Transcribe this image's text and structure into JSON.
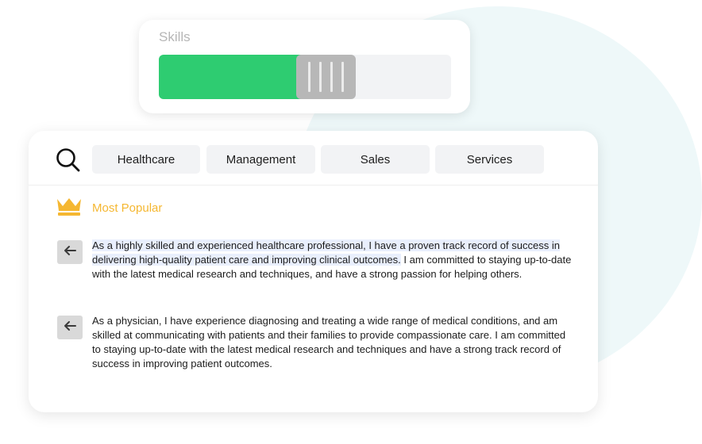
{
  "skills": {
    "title": "Skills",
    "level": 0.53,
    "fill_color": "#2ecc71",
    "handle_color": "#b7b7b7"
  },
  "search": {
    "icon": "search-icon"
  },
  "tags": [
    {
      "label": "Healthcare"
    },
    {
      "label": "Management"
    },
    {
      "label": "Sales"
    },
    {
      "label": "Services"
    }
  ],
  "popular": {
    "icon": "crown-icon",
    "label": "Most Popular",
    "color": "#f5b731"
  },
  "suggestions": [
    {
      "icon": "arrow-left-icon",
      "highlighted": "As a highly skilled and experienced healthcare professional, I have a proven track record of success in delivering high-quality patient care and improving clinical outcomes.",
      "rest": " I am committed to staying up-to-date with the latest medical research and techniques, and have a strong passion for helping others."
    },
    {
      "icon": "arrow-left-icon",
      "highlighted": "",
      "rest": "As a physician, I have experience diagnosing and treating a wide range of medical conditions, and am skilled at communicating with patients and their families to provide compassionate care. I am committed to staying up-to-date with the latest medical research and techniques and have a strong track record of success in improving patient outcomes."
    }
  ]
}
